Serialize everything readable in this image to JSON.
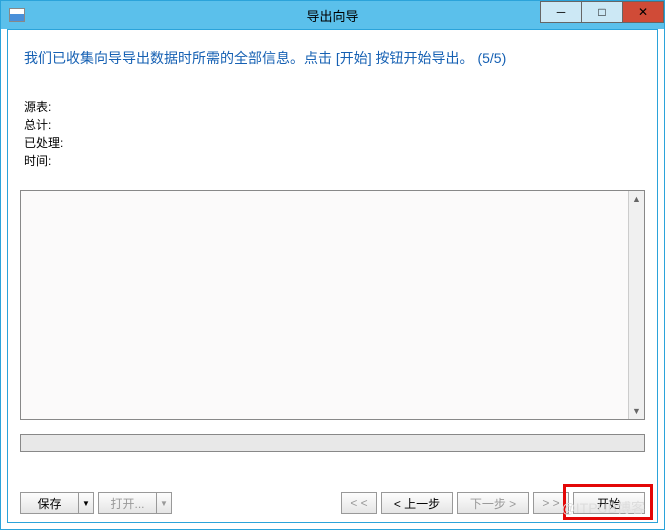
{
  "titlebar": {
    "title": "导出向导"
  },
  "instruction": "我们已收集向导导出数据时所需的全部信息。点击 [开始] 按钮开始导出。 (5/5)",
  "info": {
    "source": "源表:",
    "total": "总计:",
    "processed": "已处理:",
    "time": "时间:"
  },
  "buttons": {
    "save": "保存",
    "open": "打开...",
    "first": "< <",
    "prev": "< 上一步",
    "next": "下一步 >",
    "last": "> >",
    "start": "开始"
  },
  "watermark": "@ITPUB博客"
}
